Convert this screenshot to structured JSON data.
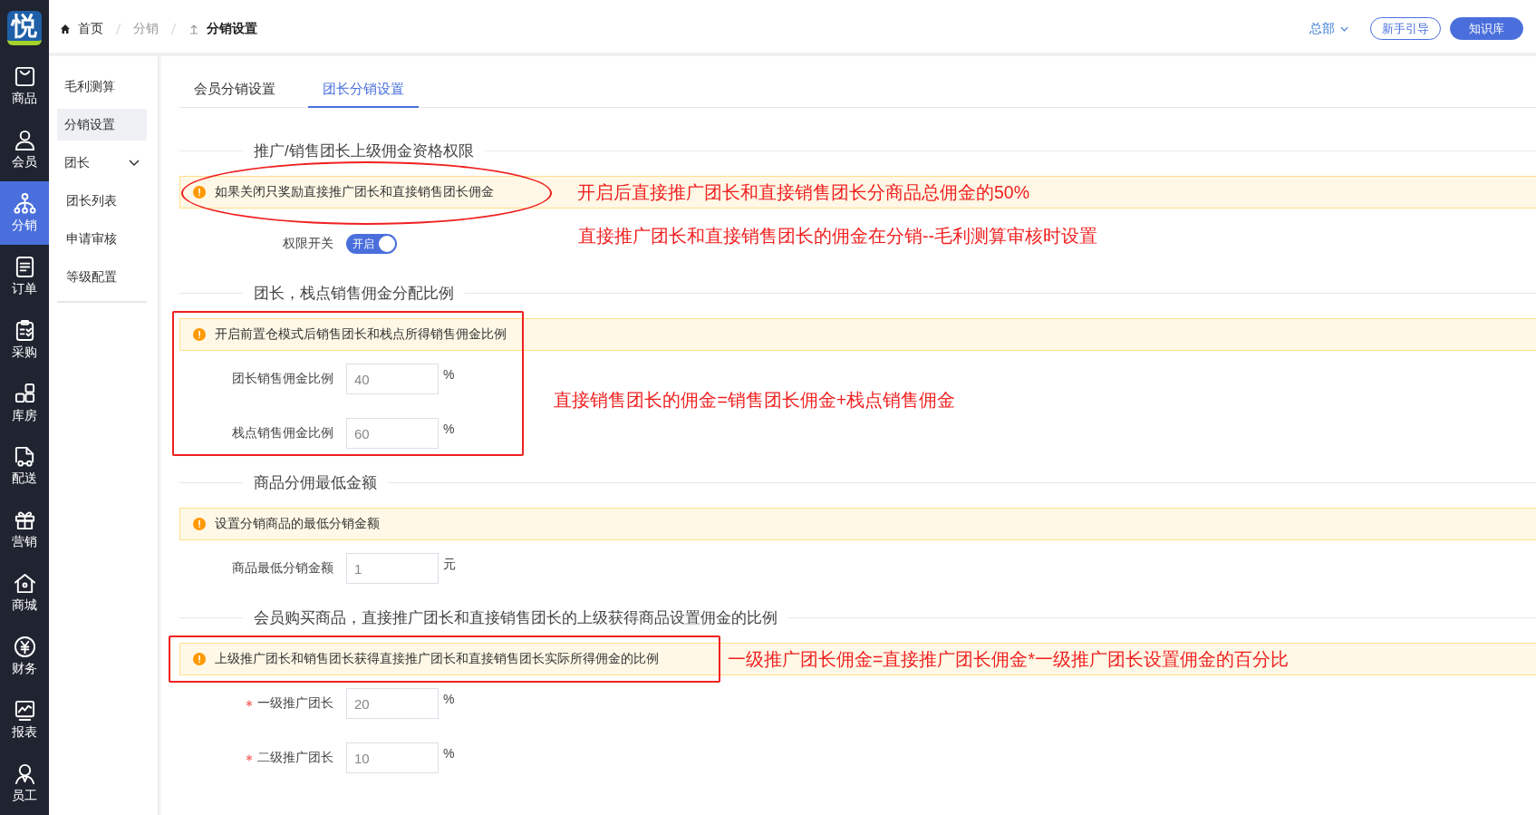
{
  "logo": {
    "text": "悦"
  },
  "nav": [
    {
      "label": "商品",
      "selected": false
    },
    {
      "label": "会员",
      "selected": false
    },
    {
      "label": "分销",
      "selected": true
    },
    {
      "label": "订单",
      "selected": false
    },
    {
      "label": "采购",
      "selected": false
    },
    {
      "label": "库房",
      "selected": false
    },
    {
      "label": "配送",
      "selected": false
    },
    {
      "label": "营销",
      "selected": false
    },
    {
      "label": "商城",
      "selected": false
    },
    {
      "label": "财务",
      "selected": false
    },
    {
      "label": "报表",
      "selected": false
    },
    {
      "label": "员工",
      "selected": false
    }
  ],
  "breadcrumb": [
    {
      "label": "首页",
      "current": false
    },
    {
      "label": "分销",
      "current": false
    },
    {
      "label": "分销设置",
      "current": true
    }
  ],
  "header": {
    "branch": "总部",
    "buttons": [
      {
        "label": "新手引导",
        "kind": "outline"
      },
      {
        "label": "知识库",
        "kind": "primary"
      }
    ]
  },
  "submenu": [
    {
      "label": "毛利测算",
      "selected": false
    },
    {
      "label": "分销设置",
      "selected": true
    },
    {
      "label": "团长",
      "expanded": true,
      "children": [
        {
          "label": "团长列表",
          "selected": false
        },
        {
          "label": "申请审核",
          "selected": false
        },
        {
          "label": "等级配置",
          "selected": false
        }
      ]
    }
  ],
  "tabs": [
    {
      "label": "会员分销设置",
      "selected": false
    },
    {
      "label": "团长分销设置",
      "selected": true
    }
  ],
  "sections": [
    {
      "title": "推广/销售团长上级佣金资格权限",
      "alert": "如果关闭只奖励直接推广团长和直接销售团长佣金",
      "alert_note": "开启后直接推广团长和直接销售团长分商品总佣金的50%",
      "fields": [
        {
          "kind": "switch",
          "label": "权限开关",
          "on": true,
          "text": "开启"
        }
      ],
      "fields_note": "直接推广团长和直接销售团长的佣金在分销--毛利测算审核时设置"
    },
    {
      "title": "团长，栈点销售佣金分配比例",
      "alert": "开启前置仓模式后销售团长和栈点所得销售佣金比例",
      "fields": [
        {
          "kind": "input",
          "label": "团长销售佣金比例",
          "value": "40",
          "unit": "%",
          "required": false
        },
        {
          "kind": "input",
          "label": "栈点销售佣金比例",
          "value": "60",
          "unit": "%",
          "required": false
        }
      ],
      "fields_note": "直接销售团长的佣金=销售团长佣金+栈点销售佣金"
    },
    {
      "title": "商品分佣最低金额",
      "alert": "设置分销商品的最低分销金额",
      "fields": [
        {
          "kind": "input",
          "label": "商品最低分销金额",
          "value": "1",
          "unit": "元",
          "required": false
        }
      ]
    },
    {
      "title": "会员购买商品，直接推广团长和直接销售团长的上级获得商品设置佣金的比例",
      "alert": "上级推广团长和销售团长获得直接推广团长和直接销售团长实际所得佣金的比例",
      "alert_note": "一级推广团长佣金=直接推广团长佣金*一级推广团长设置佣金的百分比",
      "fields": [
        {
          "kind": "input",
          "label": "一级推广团长",
          "value": "20",
          "unit": "%",
          "required": true
        },
        {
          "kind": "input",
          "label": "二级推广团长",
          "value": "10",
          "unit": "%",
          "required": true
        }
      ]
    }
  ]
}
